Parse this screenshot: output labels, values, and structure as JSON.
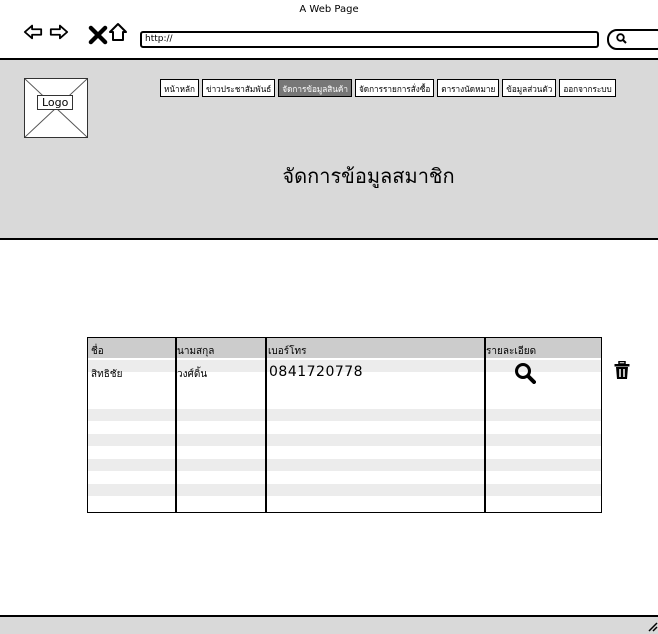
{
  "window": {
    "title": "A Web Page"
  },
  "browser": {
    "url": "http://"
  },
  "logo": {
    "label": "Logo"
  },
  "menu": [
    {
      "label": "หน้าหลัก",
      "active": false
    },
    {
      "label": "ข่าวประชาสัมพันธ์",
      "active": false
    },
    {
      "label": "จัดการข้อมูลสินค้า",
      "active": true
    },
    {
      "label": "จัดการรายการสั่งซื้อ",
      "active": false
    },
    {
      "label": "ตารางนัดหมาย",
      "active": false
    },
    {
      "label": "ข้อมูลส่วนตัว",
      "active": false
    },
    {
      "label": "ออกจากระบบ",
      "active": false
    }
  ],
  "page": {
    "title": "จัดการข้อมูลสมาชิก"
  },
  "table": {
    "headers": [
      "ชื่อ",
      "นามสกุล",
      "เบอร์โทร",
      "รายละเอียด"
    ],
    "rows": [
      {
        "first_name": "สิทธิชัย",
        "last_name": "วงศ์ดิ้น",
        "phone": "0841720778"
      }
    ]
  },
  "icons": {
    "details": "search-icon",
    "delete": "trash-icon"
  }
}
